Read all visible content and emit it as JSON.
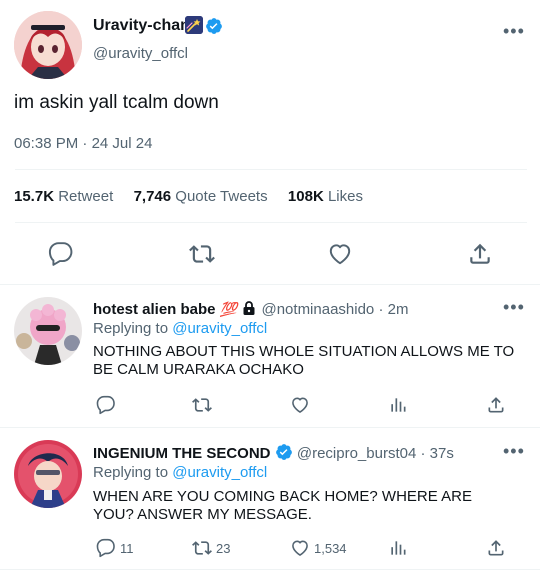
{
  "main_tweet": {
    "display_name": "Uravity-chan",
    "handle": "@uravity_offcl",
    "text": "im askin yall tcalm down",
    "time": "06:38 PM",
    "date": "24 Jul 24",
    "retweets_count": "15.7K",
    "retweets_label": "Retweet",
    "quotes_count": "7,746",
    "quotes_label": "Quote Tweets",
    "likes_count": "108K",
    "likes_label": "Likes",
    "name_badge_icon": "shooting-star-emoji"
  },
  "replies": [
    {
      "display_name": "hotest alien babe",
      "name_emoji": "💯",
      "name_icon": "lock-icon",
      "handle": "@notminaashido",
      "age": "2m",
      "replying_label": "Replying to",
      "replying_to": "@uravity_offcl",
      "text": "NOTHING ABOUT THIS WHOLE SITUATION ALLOWS ME TO BE CALM URARAKA OCHAKO",
      "reply_count": "",
      "retweet_count": "",
      "like_count": ""
    },
    {
      "display_name": "INGENIUM THE SECOND",
      "handle": "@recipro_burst04",
      "age": "37s",
      "replying_label": "Replying to",
      "replying_to": "@uravity_offcl",
      "text": "WHEN ARE YOU COMING BACK HOME? WHERE ARE YOU? ANSWER MY MESSAGE.",
      "reply_count": "11",
      "retweet_count": "23",
      "like_count": "1,534"
    }
  ],
  "separators": {
    "dot": "·"
  },
  "colors": {
    "accent": "#1d9bf0",
    "muted": "#536471",
    "text": "#0f1419",
    "divider": "#eff3f4"
  }
}
